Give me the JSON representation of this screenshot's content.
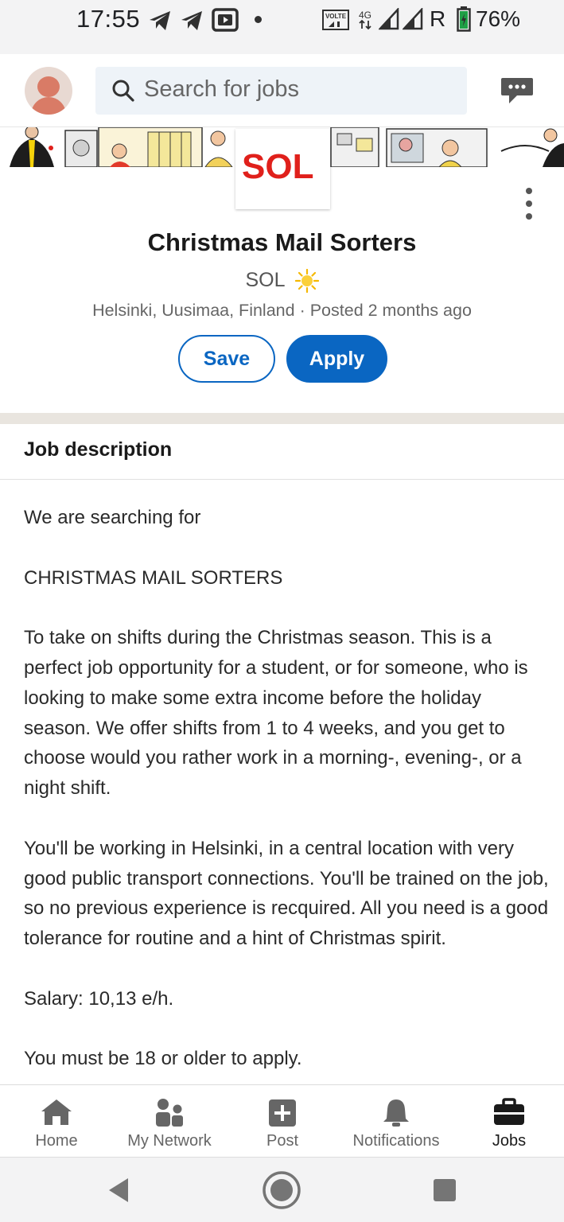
{
  "status_bar": {
    "time": "17:55",
    "volte": "VOLTE",
    "network": "4G",
    "roaming": "R",
    "battery": "76%"
  },
  "header": {
    "search_placeholder": "Search for jobs"
  },
  "job": {
    "logo_text": "SOL",
    "title": "Christmas Mail Sorters",
    "company": "SOL",
    "location": "Helsinki, Uusimaa, Finland",
    "separator": "·",
    "posted": "Posted 2 months ago",
    "save_label": "Save",
    "apply_label": "Apply"
  },
  "description": {
    "heading": "Job description",
    "paragraphs": [
      "We are searching for",
      "CHRISTMAS MAIL SORTERS",
      "To take on shifts during the Christmas season. This is a perfect job opportunity for a student, or for someone, who is looking to make some extra income before the holiday season. We offer shifts from 1 to 4 weeks, and you get to choose would you rather work in a morning-, evening-, or a night shift.",
      "You'll be working in Helsinki, in a central location with very good public transport connections. You'll be trained on the job, so no previous experience is recquired. All you need is a good tolerance for routine and a hint of Christmas spirit.",
      "Salary: 10,13 e/h.",
      "You must be 18 or older to apply."
    ]
  },
  "bottom_nav": {
    "home": "Home",
    "network": "My Network",
    "post": "Post",
    "notifications": "Notifications",
    "jobs": "Jobs"
  },
  "colors": {
    "primary": "#0a66c2",
    "logo_red": "#e0201b",
    "logo_yellow": "#f5b800",
    "divider": "#e9e5df"
  }
}
